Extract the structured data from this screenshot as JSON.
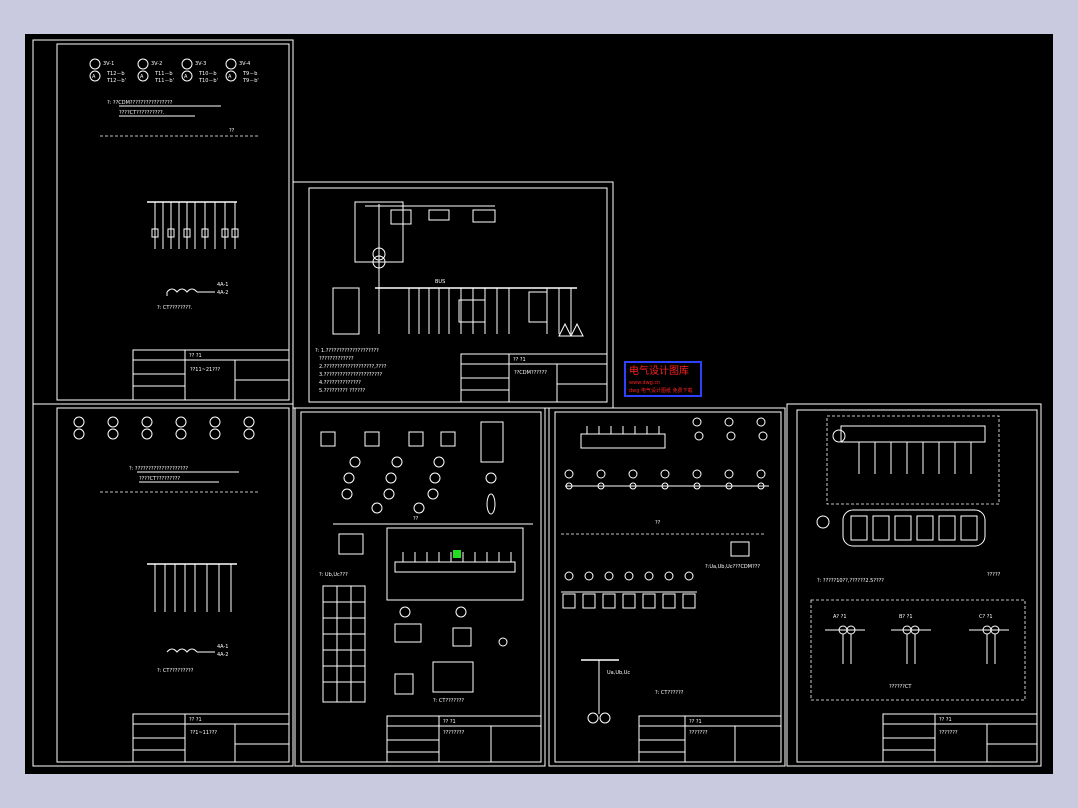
{
  "sheets": {
    "sheet1": {
      "meters": [
        {
          "code": "3V-1",
          "l1": "T12－b",
          "l2": "T12－b'"
        },
        {
          "code": "3V-2",
          "l1": "T11－b",
          "l2": "T11－b'"
        },
        {
          "code": "3V-3",
          "l1": "T10－b",
          "l2": "T10－b'"
        },
        {
          "code": "3V-4",
          "l1": "T9－b",
          "l2": "T9－b'"
        }
      ],
      "note1": "?: ??CDM????????????????",
      "note2": "????CT??????????.",
      "note3": "??",
      "ct_note": "?: CT????????.",
      "tb_title": "?? ?1",
      "tb_name": "??11~21???"
    },
    "sheet2": {
      "note1": "?: ????????????????????",
      "note2": "????CT?????????",
      "ct_note": "?: CT?????????",
      "tb_title": "?? ?1",
      "tb_name": "??1~11???"
    },
    "sheet_main": {
      "tb_title": "?? ?1",
      "tb_name": "??CDM??????"
    },
    "sheet3": {
      "note1": "??",
      "note2": "?: Ub,Uc???",
      "note3": "?: CT???????",
      "tb_title": "?? ?1",
      "tb_name": "????????"
    },
    "sheet4": {
      "note1": "??",
      "note2": "?:Ua,Ub,Uc???CDM???",
      "note3": "Ua,Ub,Uc",
      "note4": "?: CT??????",
      "tb_title": "?? ?1",
      "tb_name": "???????"
    },
    "sheet5": {
      "note1": "?: ?????10??,??????2.5????",
      "note2": "?????",
      "note3": "??????CT",
      "ct_labels": [
        "A? ?1",
        "B? ?1",
        "C? ?1"
      ],
      "tb_title": "?? ?1",
      "tb_name": "???????"
    }
  },
  "stamp": {
    "title": "电气设计图库",
    "line1": "www.dwg.cn",
    "line2": "dwg 电气设计图纸 免费下载",
    "color": "#ff0000",
    "border": "#3040ff"
  }
}
